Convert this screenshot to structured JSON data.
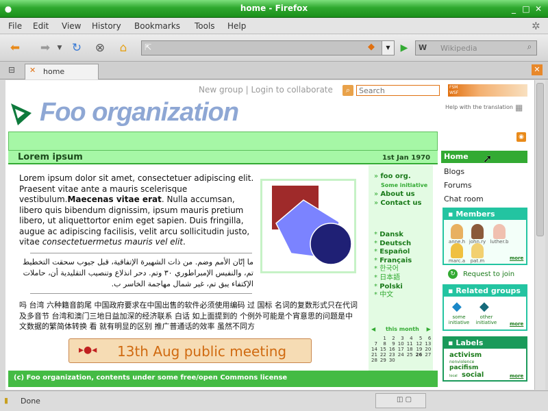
{
  "window": {
    "title": "home - Firefox"
  },
  "menu": [
    "File",
    "Edit",
    "View",
    "History",
    "Bookmarks",
    "Tools",
    "Help"
  ],
  "nav": {
    "search_placeholder": "Wikipedia"
  },
  "tab": {
    "label": "home"
  },
  "site": {
    "top_links": [
      "New group",
      "Login to collaborate"
    ],
    "search_placeholder": "Search",
    "logo_text": "Foo organization",
    "help_translation": "Help with the translation",
    "badge": "FSM WSF"
  },
  "article": {
    "title": "Lorem ipsum",
    "date": "1st Jan 1970",
    "body1": "Lorem ipsum dolor sit amet, consectetuer adipiscing elit. Praesent vitae ante a mauris scelerisque vestibulum.",
    "body_bold": "Maecenas vitae erat",
    "body2": ". Nulla accumsan, libero quis bibendum dignissim, ipsum mauris pretium libero, ut aliquettortor enim eget sapien. Duis fringilla, augue ac adipiscing facilisis, velit arcu sollicitudin justo, vitae ",
    "body_italic": "consectetuermetus mauris vel elit",
    "body_end": ".",
    "arabic": "ما إتّان الأمم وضم. من ذات الشهيرة الإتفاقية، قبل جيوب سحقت التخطيط تم، والنفيس الإمبراطوري ٣٠ وتم. دحر انذلاع وتنصيب التقليدية أن، حاملات الإكتفاء يبق تم، غير شمال مهاجمة الخاسر ب.",
    "cjk": "吗 台湾 六种籍音韵尾 中国政府要求在中国出售的软件必须使用编码 过 国标 名词的复数形式只在代词及多音节 台湾和澳门三地日益加深的经济联系 白话 如上面提到的 个例外可能是个宵意思的问题是中文数据的繁简体转换 看 就有明显的区别 推广普通话的效率 虽然不同方",
    "event_label": "13th Aug public meeting",
    "footer": "(c) Foo organization, contents under some free/open Commons license"
  },
  "mid_links": {
    "foo_org": "foo org.",
    "initiative": "Some initiative",
    "about": "About us",
    "contact": "Contact us"
  },
  "languages": [
    "Dansk",
    "Deutsch",
    "Español",
    "Français",
    "한국어",
    "日本語",
    "Polski",
    "中文"
  ],
  "calendar": {
    "label": "this month",
    "rows": [
      [
        "",
        "1",
        "2",
        "3",
        "4",
        "5",
        "6"
      ],
      [
        "7",
        "8",
        "9",
        "10",
        "11",
        "12",
        "13"
      ],
      [
        "14",
        "15",
        "16",
        "17",
        "18",
        "19",
        "20"
      ],
      [
        "21",
        "22",
        "23",
        "24",
        "25",
        "26",
        "27"
      ],
      [
        "28",
        "29",
        "30",
        "",
        "",
        "",
        ""
      ]
    ]
  },
  "sidebar": {
    "home": "Home",
    "blogs": "Blogs",
    "forums": "Forums",
    "chat": "Chat room",
    "members_title": "Members",
    "members": [
      "anne.h",
      "john.ry",
      "luther.b",
      "marc.a",
      "pat.m"
    ],
    "more": "more",
    "request": "Request to join",
    "related_title": "Related groups",
    "related": [
      "some initiative",
      "other initiative"
    ],
    "labels_title": "Labels",
    "labels": [
      "activism",
      "nonviolence",
      "pacifism",
      "local",
      "social"
    ]
  },
  "status": {
    "text": "Done"
  },
  "colors": {
    "accent": "#33aa33",
    "light_green": "#a6f7a6",
    "teal": "#23c4a1",
    "orange": "#e07010",
    "logo_blue": "#8ea7d4",
    "event_bg": "#f6dcb4",
    "event_border": "#c9864c",
    "event_text": "#d06a10",
    "square": "#9f2a2a",
    "pentagon": "#7b83ff",
    "circle": "#1f2075"
  }
}
